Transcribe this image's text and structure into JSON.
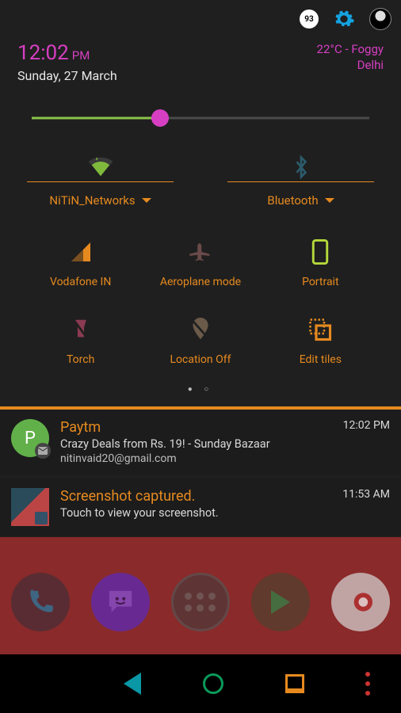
{
  "topbar": {
    "badge_count": "93"
  },
  "clock": {
    "time": "12:02",
    "ampm": "PM",
    "date": "Sunday, 27 March"
  },
  "weather": {
    "summary": "22°C - Foggy",
    "location": "Delhi"
  },
  "brightness": {
    "percent": 38
  },
  "wifi": {
    "label": "NiTiN_Networks",
    "active": true
  },
  "bluetooth": {
    "label": "Bluetooth",
    "active": false
  },
  "tiles": [
    {
      "id": "cellular",
      "label": "Vodafone IN",
      "icon": "signal"
    },
    {
      "id": "airplane",
      "label": "Aeroplane mode",
      "icon": "airplane"
    },
    {
      "id": "rotation",
      "label": "Portrait",
      "icon": "portrait"
    },
    {
      "id": "torch",
      "label": "Torch",
      "icon": "torch"
    },
    {
      "id": "location",
      "label": "Location Off",
      "icon": "location-off"
    },
    {
      "id": "edit",
      "label": "Edit tiles",
      "icon": "edit-tiles"
    }
  ],
  "notifications": [
    {
      "app": "Paytm",
      "title": "Paytm",
      "line": "Crazy Deals from Rs. 19! - Sunday Bazaar",
      "sub": "nitinvaid20@gmail.com",
      "time": "12:02 PM",
      "badge_letter": "P",
      "icon_kind": "letter"
    },
    {
      "app": "Screenshot",
      "title": "Screenshot captured.",
      "line": "Touch to view your screenshot.",
      "sub": "",
      "time": "11:53 AM",
      "icon_kind": "thumb"
    }
  ]
}
